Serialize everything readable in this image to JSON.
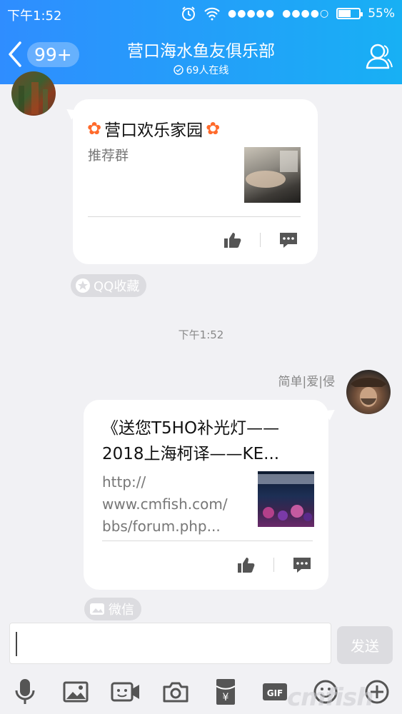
{
  "status_bar": {
    "time": "下午1:52",
    "battery": "55%",
    "battery_fraction": 0.55
  },
  "header": {
    "unread_badge": "99+",
    "title": "营口海水鱼友俱乐部",
    "online": "69人在线"
  },
  "messages": [
    {
      "card_title": "营口欢乐家园",
      "card_desc": "推荐群",
      "source": "QQ收藏"
    },
    {
      "sender": "简单|爱|侵",
      "card_title_line1": "《送您T5HO补光灯——",
      "card_title_line2": "2018上海柯译——KE...",
      "card_desc_line1": "http://",
      "card_desc_line2": "www.cmfish.com/",
      "card_desc_line3": "bbs/forum.php...",
      "source": "微信"
    }
  ],
  "time_separator": "下午1:52",
  "composer": {
    "value": "",
    "send_label": "发送"
  },
  "toolbar": [
    "mic-icon",
    "image-icon",
    "video-call-icon",
    "camera-icon",
    "red-packet-icon",
    "gif-icon",
    "emoji-icon",
    "plus-icon"
  ],
  "colors": {
    "header_start": "#2f8dff",
    "header_end": "#18b0f4",
    "background": "#f1f1f4",
    "icon_gray": "#555"
  }
}
